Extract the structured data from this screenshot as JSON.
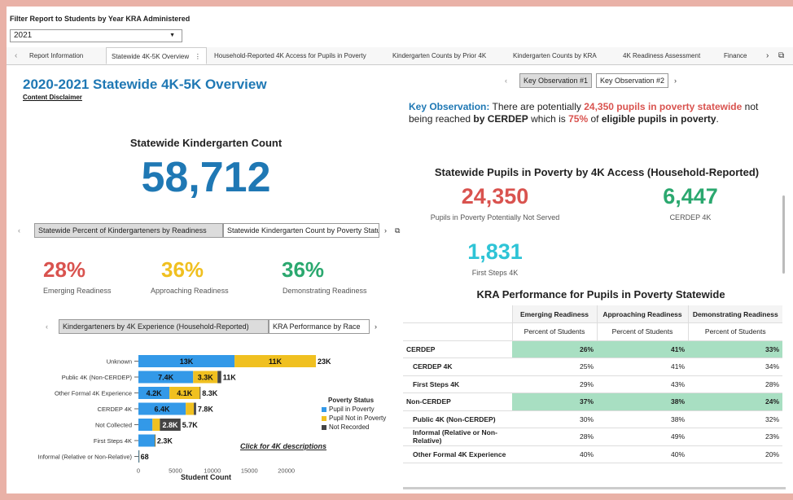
{
  "filter": {
    "label": "Filter Report to Students by Year KRA Administered",
    "value": "2021"
  },
  "tabs": [
    "Report Information",
    "Statewide 4K-5K Overview",
    "Household-Reported 4K Access for Pupils in Poverty",
    "Kindergarten Counts by Prior 4K",
    "Kindergarten Counts by KRA",
    "4K Readiness Assessment",
    "Finance"
  ],
  "title": "2020-2021 Statewide 4K-5K Overview",
  "disclaimer": "Content Disclaimer",
  "kc": {
    "label": "Statewide Kindergarten Count",
    "value": "58,712"
  },
  "readiness_tabs": [
    "Statewide Percent of Kindergarteners by Readiness",
    "Statewide Kindergarten Count by Poverty Status"
  ],
  "readiness": [
    {
      "value": "28%",
      "label": "Emerging Readiness",
      "color": "#d9534f"
    },
    {
      "value": "36%",
      "label": "Approaching Readiness",
      "color": "#f0c020"
    },
    {
      "value": "36%",
      "label": "Demonstrating Readiness",
      "color": "#2ba86f"
    }
  ],
  "chart_tabs": [
    "Kindergarteners by 4K Experience (Household-Reported)",
    "KRA Performance by Race"
  ],
  "key_tabs": [
    "Key Observation #1",
    "Key Observation #2"
  ],
  "key_obs": {
    "lead": "Key Observation:",
    "t1": " There are potentially ",
    "h1": "24,350 pupils in poverty statewide",
    "t2": " not being reached ",
    "h2": "by CERDEP",
    "t3": " which is ",
    "h3": "75%",
    "t4": " of ",
    "h4": "eligible pupils in poverty",
    "t5": "."
  },
  "poverty": {
    "title": "Statewide Pupils in Poverty by 4K Access (Household-Reported)",
    "not_served": {
      "value": "24,350",
      "label": "Pupils in Poverty Potentially Not Served"
    },
    "cerdep": {
      "value": "6,447",
      "label": "CERDEP 4K"
    },
    "first_steps": {
      "value": "1,831",
      "label": "First Steps 4K"
    }
  },
  "kra_table": {
    "title": "KRA Performance for Pupils in Poverty Statewide",
    "headers": [
      "Emerging Readiness",
      "Approaching Readiness",
      "Demonstrating Readiness"
    ],
    "subheader": "Percent of Students",
    "rows": [
      {
        "label": "CERDEP",
        "values": [
          "26%",
          "41%",
          "33%"
        ],
        "group": true
      },
      {
        "label": "CERDEP 4K",
        "values": [
          "25%",
          "41%",
          "34%"
        ],
        "group": false
      },
      {
        "label": "First Steps 4K",
        "values": [
          "29%",
          "43%",
          "28%"
        ],
        "group": false
      },
      {
        "label": "Non-CERDEP",
        "values": [
          "37%",
          "38%",
          "24%"
        ],
        "group": true
      },
      {
        "label": "Public 4K (Non-CERDEP)",
        "values": [
          "30%",
          "38%",
          "32%"
        ],
        "group": false
      },
      {
        "label": "Informal (Relative or Non-Relative)",
        "values": [
          "28%",
          "49%",
          "23%"
        ],
        "group": false
      },
      {
        "label": "Other Formal 4K Experience",
        "values": [
          "40%",
          "40%",
          "20%"
        ],
        "group": false
      }
    ]
  },
  "legend": {
    "title": "Poverty Status",
    "items": [
      "Pupil in Poverty",
      "Pupil Not in Poverty",
      "Not Recorded"
    ]
  },
  "click_desc": "Click for 4K descriptions",
  "chart_data": {
    "type": "bar",
    "orientation": "horizontal",
    "stacked": true,
    "categories": [
      "Unknown",
      "Public 4K (Non-CERDEP)",
      "Other Formal 4K Experience",
      "CERDEP 4K",
      "Not Collected",
      "First Steps 4K",
      "Informal (Relative or Non-Relative)"
    ],
    "series": [
      {
        "name": "Pupil in Poverty",
        "color": "#3399e8",
        "values": [
          13000,
          7400,
          4200,
          6400,
          1900,
          2200,
          50
        ]
      },
      {
        "name": "Pupil Not in Poverty",
        "color": "#f0c020",
        "values": [
          11000,
          3300,
          4100,
          1100,
          1000,
          50,
          10
        ]
      },
      {
        "name": "Not Recorded",
        "color": "#444444",
        "values": [
          0,
          500,
          100,
          300,
          2800,
          50,
          8
        ]
      }
    ],
    "segment_labels": [
      [
        "13K",
        "11K",
        ""
      ],
      [
        "7.4K",
        "3.3K",
        ""
      ],
      [
        "4.2K",
        "4.1K",
        ""
      ],
      [
        "6.4K",
        "",
        ""
      ],
      [
        "",
        "",
        "2.8K"
      ],
      [
        "",
        "",
        ""
      ],
      [
        "",
        "",
        ""
      ]
    ],
    "totals": [
      "23K",
      "11K",
      "8.3K",
      "7.8K",
      "5.7K",
      "2.3K",
      "68"
    ],
    "xlabel": "Student Count",
    "xlim": [
      0,
      24000
    ],
    "xticks": [
      0,
      5000,
      10000,
      15000,
      20000
    ]
  }
}
